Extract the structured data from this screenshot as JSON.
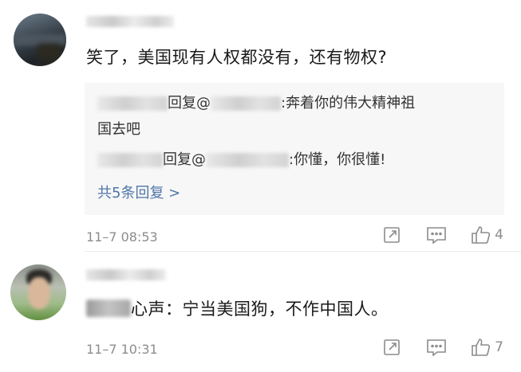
{
  "comments": [
    {
      "text": "笑了，美国现有人权都没有，还有物权?",
      "replies": [
        {
          "verb": "回复",
          "mention": "@",
          "text": ":奔着你的伟大精神祖",
          "text_cont": "国去吧"
        },
        {
          "verb": "回复",
          "mention": "@",
          "text": ":你懂，你很懂!"
        }
      ],
      "more_replies": "共5条回复 >",
      "timestamp": "11–7 08:53",
      "likes": "4"
    },
    {
      "text": "心声：宁当美国狗，不作中国人。",
      "timestamp": "11–7 10:31",
      "likes": "7"
    }
  ],
  "icons": {
    "share": "share-edit-icon",
    "comment": "comment-icon",
    "like": "thumbs-up-icon"
  },
  "colors": {
    "link": "#4f76a8",
    "meta": "#8c8c8c",
    "reply_bg": "#f7f7f7"
  }
}
